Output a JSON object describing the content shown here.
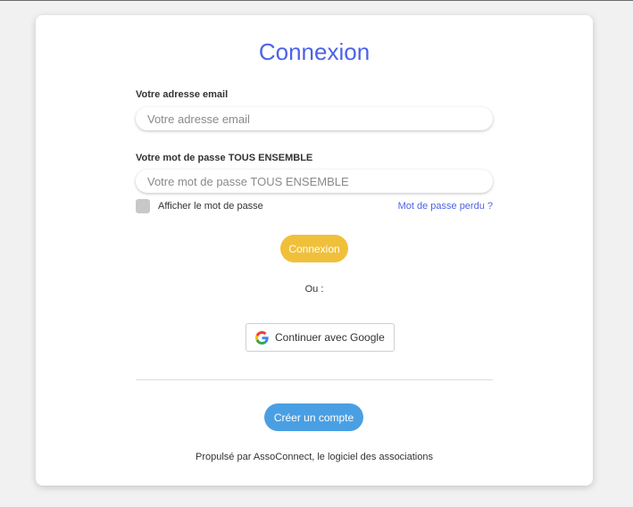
{
  "login": {
    "title": "Connexion",
    "email_label": "Votre adresse email",
    "email_placeholder": "Votre adresse email",
    "email_value": "",
    "password_label": "Votre mot de passe TOUS ENSEMBLE",
    "password_placeholder": "Votre mot de passe TOUS ENSEMBLE",
    "password_value": "",
    "show_password_label": "Afficher le mot de passe",
    "forgot_password_link": "Mot de passe perdu ?",
    "submit_label": "Connexion",
    "or_text": "Ou :",
    "google_label": "Continuer avec Google",
    "create_account_label": "Créer un compte",
    "footer_text": "Propulsé par AssoConnect, le logiciel des associations"
  },
  "colors": {
    "title": "#4c63e8",
    "submit_button": "#f0c03a",
    "create_button": "#4a9fe3",
    "link": "#4c63e8"
  },
  "icons": {
    "google": "google-g-logo"
  }
}
